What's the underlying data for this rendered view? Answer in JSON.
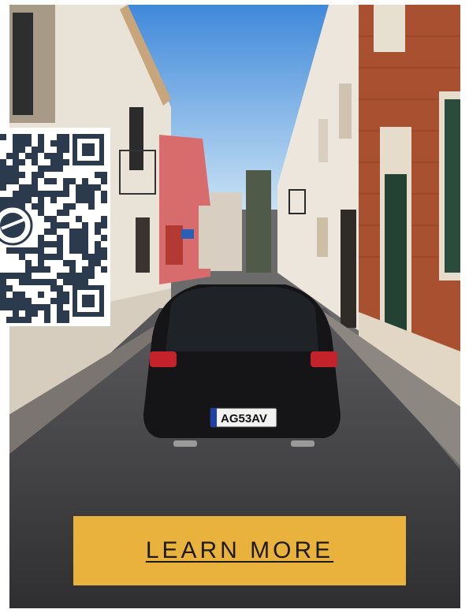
{
  "photo": {
    "alt": "",
    "plate": "AG53AV",
    "colors": {
      "sky": "#4d93df",
      "sky_light": "#b9d9f3",
      "road": "#3e3e40",
      "car": "#151517",
      "brick": "#a5492a",
      "plaster": "#ece5d9",
      "cta": "#e8b23d"
    }
  },
  "qr": {
    "icon": "qr-code-icon",
    "logo_icon": "globe-logo-icon"
  },
  "cta": {
    "label": "LEARN MORE"
  }
}
